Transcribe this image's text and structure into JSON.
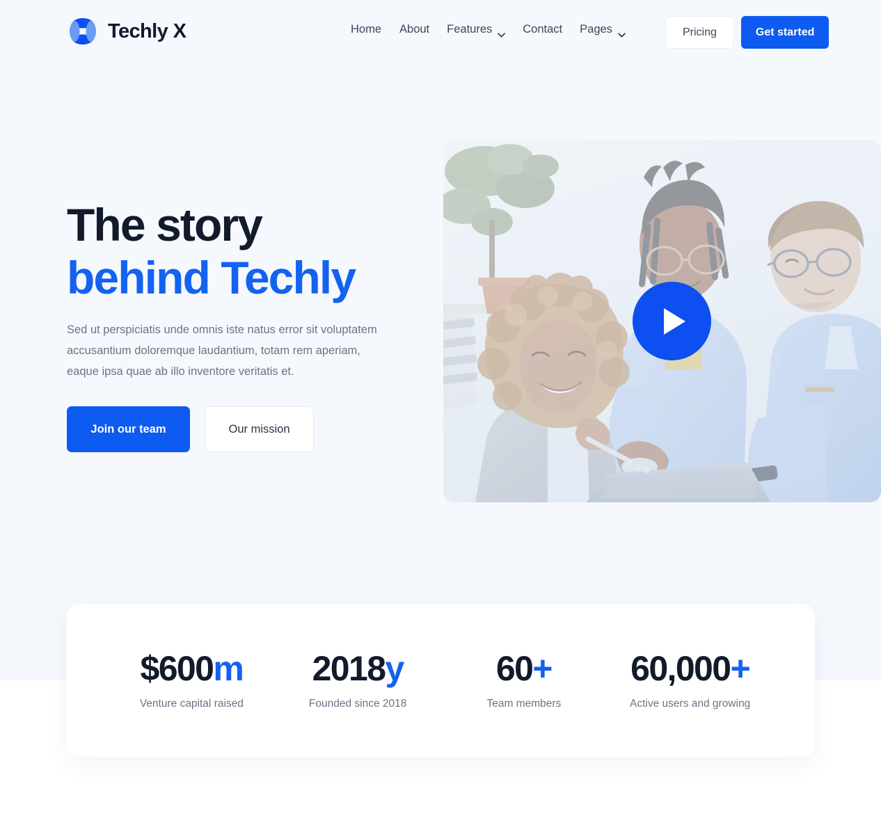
{
  "brand": {
    "name": "Techly X",
    "logo_icon": "techly-petal-logo-icon",
    "accent_color": "#0d5bf0",
    "accent_light_color": "#6a9bf5",
    "dark_color": "#121a2b"
  },
  "nav": {
    "items": [
      {
        "label": "Home",
        "has_dropdown": false
      },
      {
        "label": "About",
        "has_dropdown": false
      },
      {
        "label": "Features",
        "has_dropdown": true
      },
      {
        "label": "Contact",
        "has_dropdown": false
      },
      {
        "label": "Pages",
        "has_dropdown": true
      }
    ],
    "pricing_label": "Pricing",
    "get_started_label": "Get started"
  },
  "hero": {
    "title_line1": "The story",
    "title_line2": "behind Techly",
    "paragraph": "Sed ut perspiciatis unde omnis iste natus error sit voluptatem accusantium doloremque laudantium, totam rem aperiam, eaque ipsa quae ab illo inventore veritatis et.",
    "primary_button": "Join our team",
    "secondary_button": "Our mission",
    "media": {
      "alt": "Three colleagues collaborating around a laptop in a bright office",
      "play_icon": "play-triangle-icon",
      "overlay_color": "#0d4ff0"
    }
  },
  "stats": [
    {
      "value": "$600",
      "suffix": "m",
      "label": "Venture capital raised"
    },
    {
      "value": "2018",
      "suffix": "y",
      "label": "Founded since 2018"
    },
    {
      "value": "60",
      "suffix": "+",
      "label": "Team members"
    },
    {
      "value": "60,000",
      "suffix": "+",
      "label": "Active users and growing"
    }
  ]
}
